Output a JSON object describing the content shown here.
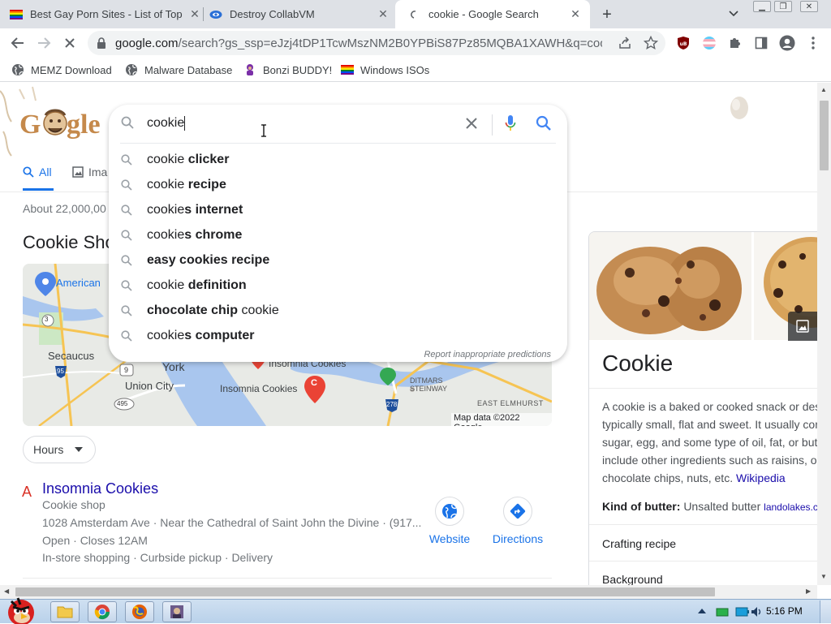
{
  "tabs": [
    {
      "title": "Best Gay Porn Sites - List of Top",
      "favicon": "rainbow-flag-icon"
    },
    {
      "title": "Destroy CollabVM",
      "favicon": "collabvm-icon"
    },
    {
      "title": "cookie - Google Search",
      "favicon": "loading-icon",
      "active": true
    }
  ],
  "toolbar": {
    "url_domain": "google.com",
    "url_rest": "/search?gs_ssp=eJzj4tDP1TcwMszNM2B0YPBiS87Pz85MQBA1XAWH&q=coo..."
  },
  "bookmarks": [
    {
      "label": "MEMZ Download",
      "icon": "globe-icon"
    },
    {
      "label": "Malware Database",
      "icon": "globe-icon"
    },
    {
      "label": "Bonzi BUDDY!",
      "icon": "bonzi-icon"
    },
    {
      "label": "Windows ISOs",
      "icon": "rainbow-flag-icon"
    }
  ],
  "search": {
    "query": "cookie",
    "suggestions": [
      {
        "plain": "cookie ",
        "bold": "clicker",
        "bold_first": false
      },
      {
        "plain": "cookie ",
        "bold": "recipe",
        "bold_first": false
      },
      {
        "plain": "cookie",
        "bold": "s internet",
        "bold_first": false
      },
      {
        "plain": "cookie",
        "bold": "s chrome",
        "bold_first": false
      },
      {
        "plain": "",
        "bold": "easy cookies recipe",
        "bold_first": false
      },
      {
        "plain": "cookie ",
        "bold": "definition",
        "bold_first": false
      },
      {
        "plain": " cookie",
        "bold": "chocolate chip",
        "bold_first": true
      },
      {
        "plain": "cookie",
        "bold": "s computer",
        "bold_first": false
      }
    ],
    "report": "Report inappropriate predictions"
  },
  "page": {
    "tab_all": "All",
    "tab_images": "Ima",
    "results_count": "About 22,000,00",
    "local_title": "Cookie Sho",
    "map_labels": {
      "american": "American",
      "secaucus": "Secaucus",
      "york": "York",
      "union_city": "Union City",
      "insomnia1": "Insomnia Cookies",
      "insomnia2": "Insomnia Cookies",
      "ditmars": "DITMARS\nSTEINWAY",
      "east_elmhurst": "EAST ELMHURST",
      "copyright": "Map data ©2022 Google",
      "r3": "3",
      "r95": "95",
      "r9": "9",
      "r495": "495",
      "r278": "278",
      "pin_c": "C"
    },
    "hours_label": "Hours",
    "result": {
      "marker": "A",
      "name": "Insomnia Cookies",
      "type": "Cookie shop",
      "address": "1028 Amsterdam Ave · Near the Cathedral of Saint John the Divine · (917...",
      "hours": "Open · Closes 12AM",
      "services": "In-store shopping · Curbside pickup · Delivery",
      "website": "Website",
      "directions": "Directions"
    }
  },
  "knowledge_panel": {
    "title": "Cookie",
    "description": "A cookie is a baked or cooked snack or des typically small, flat and sweet. It usually con sugar, egg, and some type of oil, fat, or butt include other ingredients such as raisins, oa chocolate chips, nuts, etc.",
    "desc_lines": [
      "A cookie is a baked or cooked snack or des",
      "typically small, flat and sweet. It usually con",
      "sugar, egg, and some type of oil, fat, or butt",
      "include other ingredients such as raisins, oa",
      "chocolate chips, nuts, etc."
    ],
    "wiki_link": "Wikipedia",
    "butter_label": "Kind of butter:",
    "butter_value": "Unsalted butter",
    "butter_source": "landolakes.com",
    "row1": "Crafting recipe",
    "row2": "Background"
  },
  "taskbar": {
    "time": "5:16 PM"
  },
  "colors": {
    "google_blue": "#1a73e8",
    "link_blue": "#1a0dab",
    "tabstrip": "#dee1e6",
    "red_marker": "#d93025"
  }
}
